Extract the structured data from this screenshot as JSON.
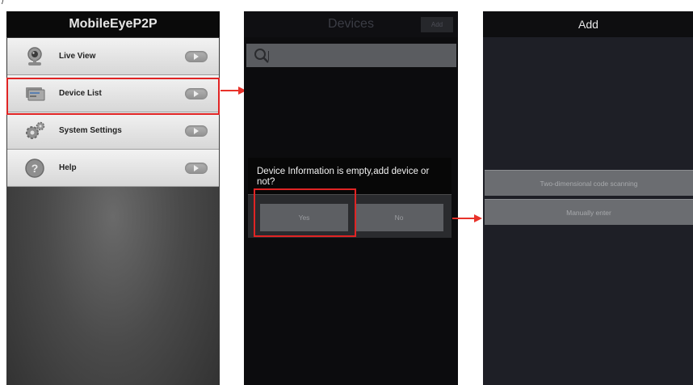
{
  "colors": {
    "highlight": "#e02424",
    "arrow": "#e8322a"
  },
  "corner_mark": "/",
  "screen1": {
    "title": "MobileEyeP2P",
    "menu": [
      {
        "label": "Live View",
        "icon": "camera-icon"
      },
      {
        "label": "Device List",
        "icon": "device-list-icon",
        "highlighted": true
      },
      {
        "label": "System Settings",
        "icon": "gears-icon"
      },
      {
        "label": "Help",
        "icon": "help-icon"
      }
    ]
  },
  "screen2": {
    "title": "Devices",
    "add_label": "Add",
    "search_icon": "search-icon",
    "dialog": {
      "message": "Device Information is empty,add device or not?",
      "yes_label": "Yes",
      "no_label": "No"
    }
  },
  "screen3": {
    "title": "Add",
    "options": [
      "Two-dimensional code scanning",
      "Manually enter"
    ]
  }
}
